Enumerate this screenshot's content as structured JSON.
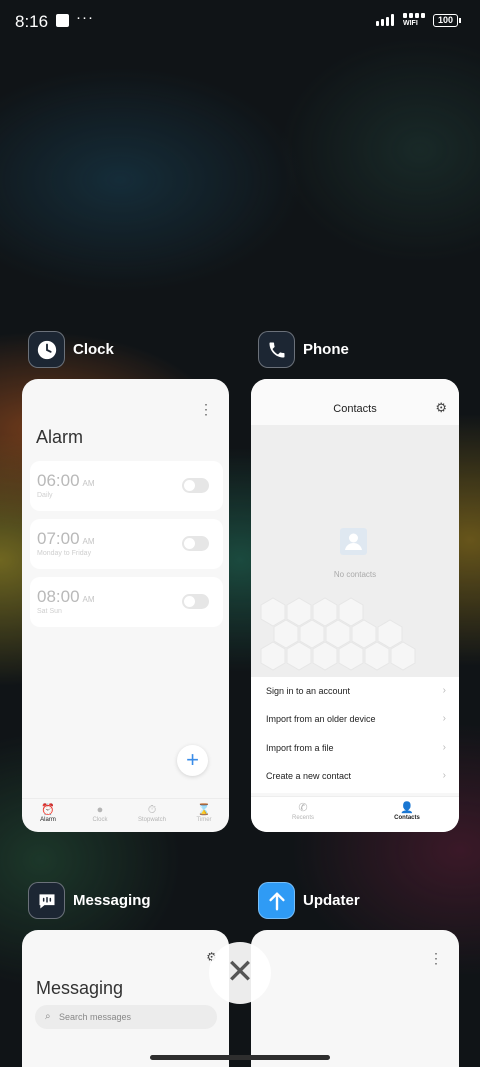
{
  "status_bar": {
    "time": "8:16",
    "more": "···",
    "wifi_label": "WIFI",
    "battery": "100"
  },
  "recents": {
    "clock": {
      "app_name": "Clock",
      "icon": "clock-icon",
      "screen_title": "Alarm",
      "menu": "⋮",
      "alarms": [
        {
          "time": "06:00",
          "ampm": "AM",
          "repeat": "Daily"
        },
        {
          "time": "07:00",
          "ampm": "AM",
          "repeat": "Monday to Friday"
        },
        {
          "time": "08:00",
          "ampm": "AM",
          "repeat": "Sat Sun"
        }
      ],
      "fab": "+",
      "tabs": [
        {
          "label": "Alarm",
          "icon": "alarm-icon"
        },
        {
          "label": "Clock",
          "icon": "clock-icon"
        },
        {
          "label": "Stopwatch",
          "icon": "stopwatch-icon"
        },
        {
          "label": "Timer",
          "icon": "timer-icon"
        }
      ]
    },
    "phone": {
      "app_name": "Phone",
      "icon": "phone-icon",
      "screen_title": "Contacts",
      "empty_text": "No contacts",
      "menu_items": [
        "Sign in to an account",
        "Import from an older device",
        "Import from a file",
        "Create a new contact"
      ],
      "tabs": [
        {
          "label": "Recents",
          "icon": "phone-icon"
        },
        {
          "label": "Contacts",
          "icon": "person-icon"
        }
      ]
    },
    "messaging": {
      "app_name": "Messaging",
      "icon": "chat-icon",
      "screen_title": "Messaging",
      "search_placeholder": "Search messages"
    },
    "updater": {
      "app_name": "Updater",
      "icon": "upload-arrow-icon",
      "menu": "⋮"
    }
  },
  "colors": {
    "accent_blue": "#3a8ce8",
    "updater_blue": "#2f9bf5"
  }
}
